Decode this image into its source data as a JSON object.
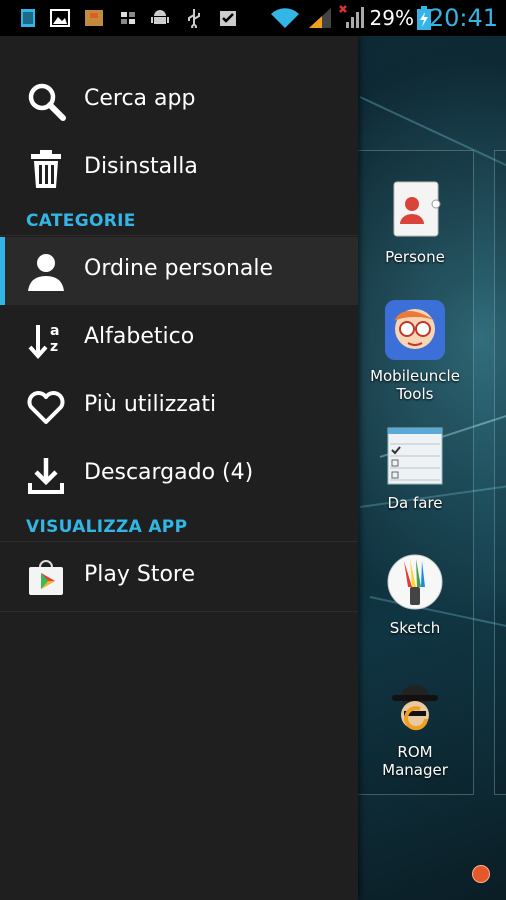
{
  "status_bar": {
    "battery_percent": "29%",
    "clock": "20:41",
    "icons": [
      "notification-icon",
      "gallery-icon",
      "package-icon",
      "blocks-icon",
      "android-icon",
      "usb-icon",
      "clipboard-check-icon",
      "wifi-icon",
      "signal-icon",
      "no-signal-icon",
      "battery-charging-icon"
    ]
  },
  "menu": {
    "top_items": [
      {
        "label": "Cerca app",
        "icon": "search-icon"
      },
      {
        "label": "Disinstalla",
        "icon": "trash-icon"
      }
    ],
    "categories_header": "CATEGORIE",
    "category_items": [
      {
        "label": "Ordine personale",
        "icon": "person-icon",
        "selected": true
      },
      {
        "label": "Alfabetico",
        "icon": "sort-az-icon",
        "selected": false
      },
      {
        "label": "Più utilizzati",
        "icon": "heart-icon",
        "selected": false
      },
      {
        "label": "Descargado (4)",
        "icon": "download-icon",
        "selected": false
      }
    ],
    "visualizza_header": "VISUALIZZA APP",
    "visualizza_items": [
      {
        "label": "Play Store",
        "icon": "play-store-icon"
      }
    ]
  },
  "apps": [
    {
      "label": "Persone",
      "icon": "contacts-icon"
    },
    {
      "label": "Mobileuncle Tools",
      "icon": "mobileuncle-icon"
    },
    {
      "label": "Da fare",
      "icon": "todo-list-icon"
    },
    {
      "label": "Sketch",
      "icon": "sketch-icon"
    },
    {
      "label": "ROM Manager",
      "icon": "rom-manager-icon"
    }
  ],
  "colors": {
    "accent": "#33b5e5",
    "menu_background": "#1f1f1f",
    "selected_background": "#2a2a2a",
    "text": "#ffffff"
  }
}
